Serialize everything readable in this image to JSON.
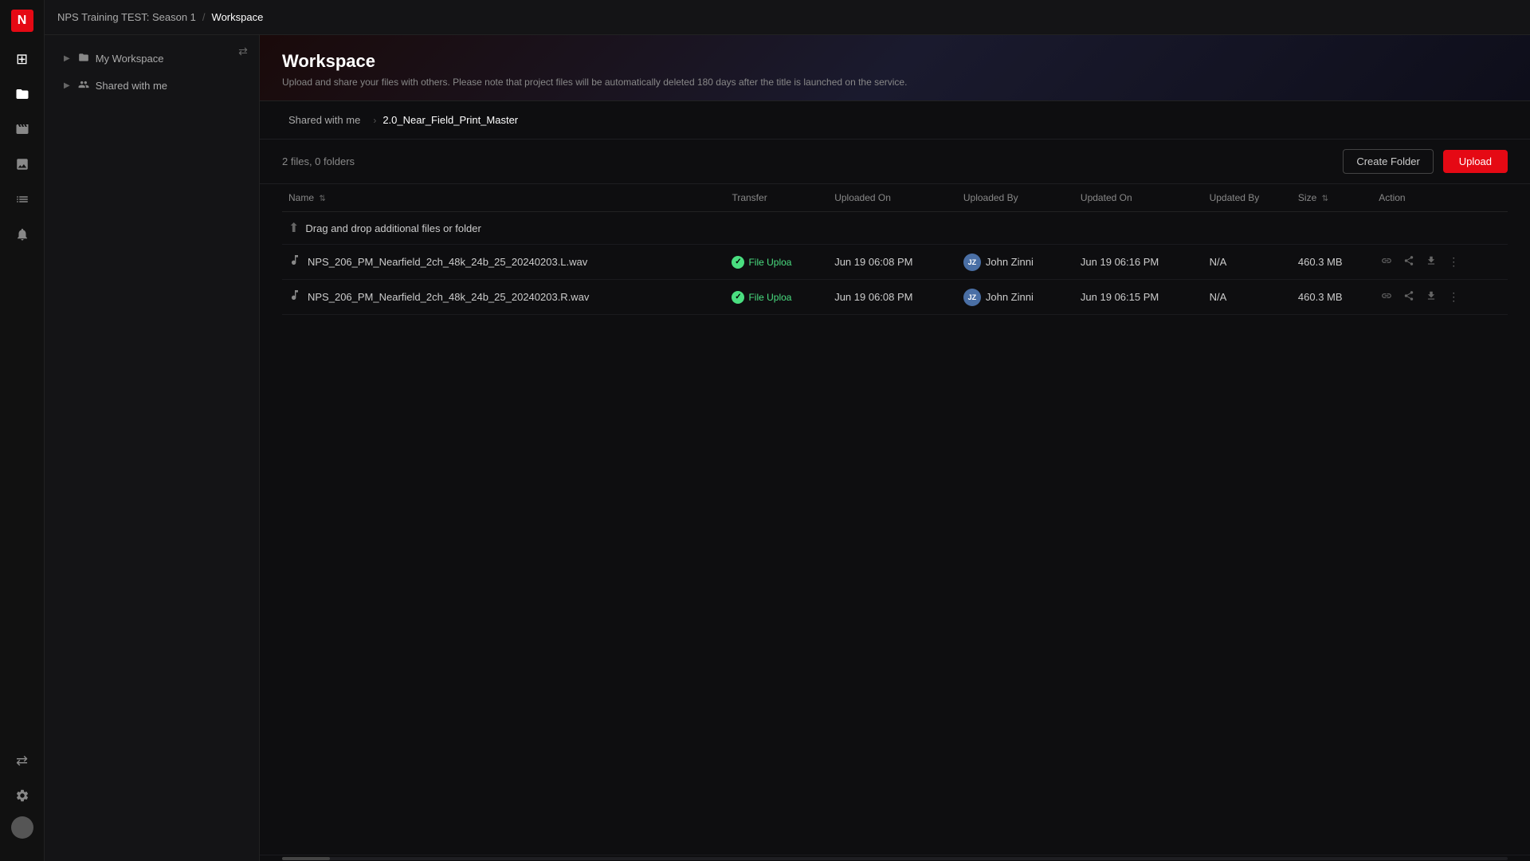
{
  "app": {
    "logo": "N",
    "title": "Workspace"
  },
  "topbar": {
    "breadcrumb": [
      {
        "label": "NPS Training TEST: Season 1",
        "active": false
      },
      {
        "label": "Workspace",
        "active": true
      }
    ],
    "separator": "/"
  },
  "sidebar_icons": [
    {
      "name": "home-icon",
      "glyph": "⊞",
      "active": false
    },
    {
      "name": "folder-icon",
      "glyph": "📁",
      "active": true
    },
    {
      "name": "film-icon",
      "glyph": "🎬",
      "active": false
    },
    {
      "name": "image-icon",
      "glyph": "🖼",
      "active": false
    },
    {
      "name": "list-icon",
      "glyph": "☰",
      "active": false
    }
  ],
  "left_nav": {
    "collapse_icon": "⇄",
    "items": [
      {
        "label": "My Workspace",
        "icon": "📁",
        "expand": "▶"
      },
      {
        "label": "Shared with me",
        "icon": "👤",
        "expand": "▶"
      }
    ]
  },
  "workspace": {
    "title": "Workspace",
    "subtitle": "Upload and share your files with others. Please note that project files will be automatically deleted 180 days after the title is launched on the service.",
    "breadcrumb": {
      "root": "Shared with me",
      "arrow": "›",
      "current": "2.0_Near_Field_Print_Master"
    },
    "file_count": "2 files, 0 folders",
    "create_folder_label": "Create Folder",
    "upload_label": "Upload"
  },
  "table": {
    "headers": [
      {
        "label": "Name",
        "sort": "⇅"
      },
      {
        "label": "Transfer",
        "sort": ""
      },
      {
        "label": "Uploaded On",
        "sort": ""
      },
      {
        "label": "Uploaded By",
        "sort": ""
      },
      {
        "label": "Updated On",
        "sort": ""
      },
      {
        "label": "Updated By",
        "sort": ""
      },
      {
        "label": "Size",
        "sort": "⇅"
      },
      {
        "label": "Action",
        "sort": ""
      }
    ],
    "drag_drop_label": "Drag and drop additional files or folder",
    "rows": [
      {
        "name": "NPS_206_PM_Nearfield_2ch_48k_24b_25_20240203.L.wav",
        "transfer": "File Uploa",
        "transfer_status": "success",
        "uploaded_on": "Jun 19 06:08 PM",
        "uploaded_by_initials": "JZ",
        "uploaded_by_name": "John Zinni",
        "updated_on": "Jun 19 06:16 PM",
        "updated_by": "N/A",
        "size": "460.3 MB"
      },
      {
        "name": "NPS_206_PM_Nearfield_2ch_48k_24b_25_20240203.R.wav",
        "transfer": "File Uploa",
        "transfer_status": "success",
        "uploaded_on": "Jun 19 06:08 PM",
        "uploaded_by_initials": "JZ",
        "uploaded_by_name": "John Zinni",
        "updated_on": "Jun 19 06:15 PM",
        "updated_by": "N/A",
        "size": "460.3 MB"
      }
    ]
  },
  "bottom_sidebar": {
    "expand_icon": "⇄",
    "settings_icon": "⚙",
    "avatar_bg": "#555"
  }
}
